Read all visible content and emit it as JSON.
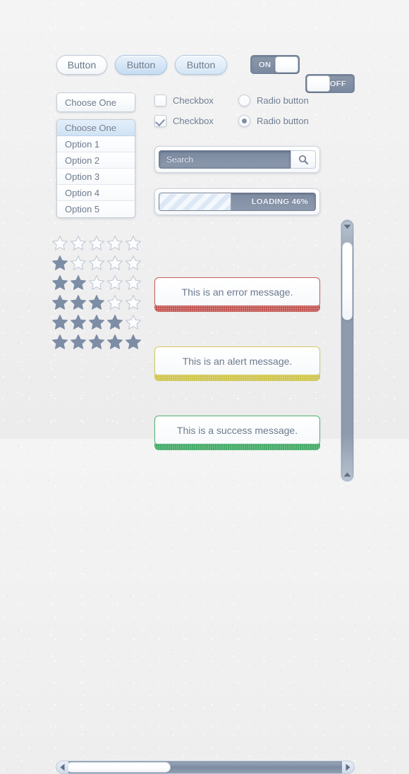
{
  "buttons": [
    {
      "label": "Button",
      "state": "default"
    },
    {
      "label": "Button",
      "state": "hover"
    },
    {
      "label": "Button",
      "state": "active"
    }
  ],
  "toggles": [
    {
      "label": "ON",
      "state": "on"
    },
    {
      "label": "OFF",
      "state": "off"
    }
  ],
  "select": {
    "value": "Choose One",
    "options": [
      "Choose One",
      "Option 1",
      "Option 2",
      "Option 3",
      "Option 4",
      "Option 5"
    ],
    "selected_index": 0
  },
  "checkboxes": [
    {
      "label": "Checkbox",
      "checked": false
    },
    {
      "label": "Checkbox",
      "checked": true
    }
  ],
  "radios": [
    {
      "label": "Radio button",
      "checked": false
    },
    {
      "label": "Radio button",
      "checked": true
    }
  ],
  "search": {
    "placeholder": "Search",
    "value": "Search",
    "icon": "search-icon"
  },
  "progress": {
    "percent": 46,
    "label": "LOADING 46%"
  },
  "messages": [
    {
      "type": "error",
      "text": "This is an error message.",
      "color": "#c0504d",
      "border": "#c9605d"
    },
    {
      "type": "alert",
      "text": "This is an alert message.",
      "color": "#ccc246",
      "border": "#d3cb63"
    },
    {
      "type": "success",
      "text": "This is a success message.",
      "color": "#3aa65f",
      "border": "#51b377"
    }
  ],
  "ratings": [
    {
      "filled": 0,
      "total": 5
    },
    {
      "filled": 1,
      "total": 5
    },
    {
      "filled": 2,
      "total": 5
    },
    {
      "filled": 3,
      "total": 5
    },
    {
      "filled": 4,
      "total": 5
    },
    {
      "filled": 5,
      "total": 5
    }
  ],
  "star_colors": {
    "filled": "#7d8da6",
    "empty_stroke": "#c4ccd8"
  },
  "scrollbars": {
    "vertical": {
      "thumb_position_percent": 4,
      "thumb_size_percent": 30,
      "up_icon": "chevron-up-icon",
      "down_icon": "chevron-down-icon"
    },
    "horizontal": {
      "thumb_position_percent": 0,
      "thumb_size_percent": 35,
      "left_icon": "chevron-left-icon",
      "right_icon": "chevron-right-icon"
    }
  },
  "palette": {
    "background": "#f1f1f1",
    "text": "#6b7a8d",
    "accent_blue": "#cfe3f5",
    "control_dark": "#8b98ab"
  }
}
